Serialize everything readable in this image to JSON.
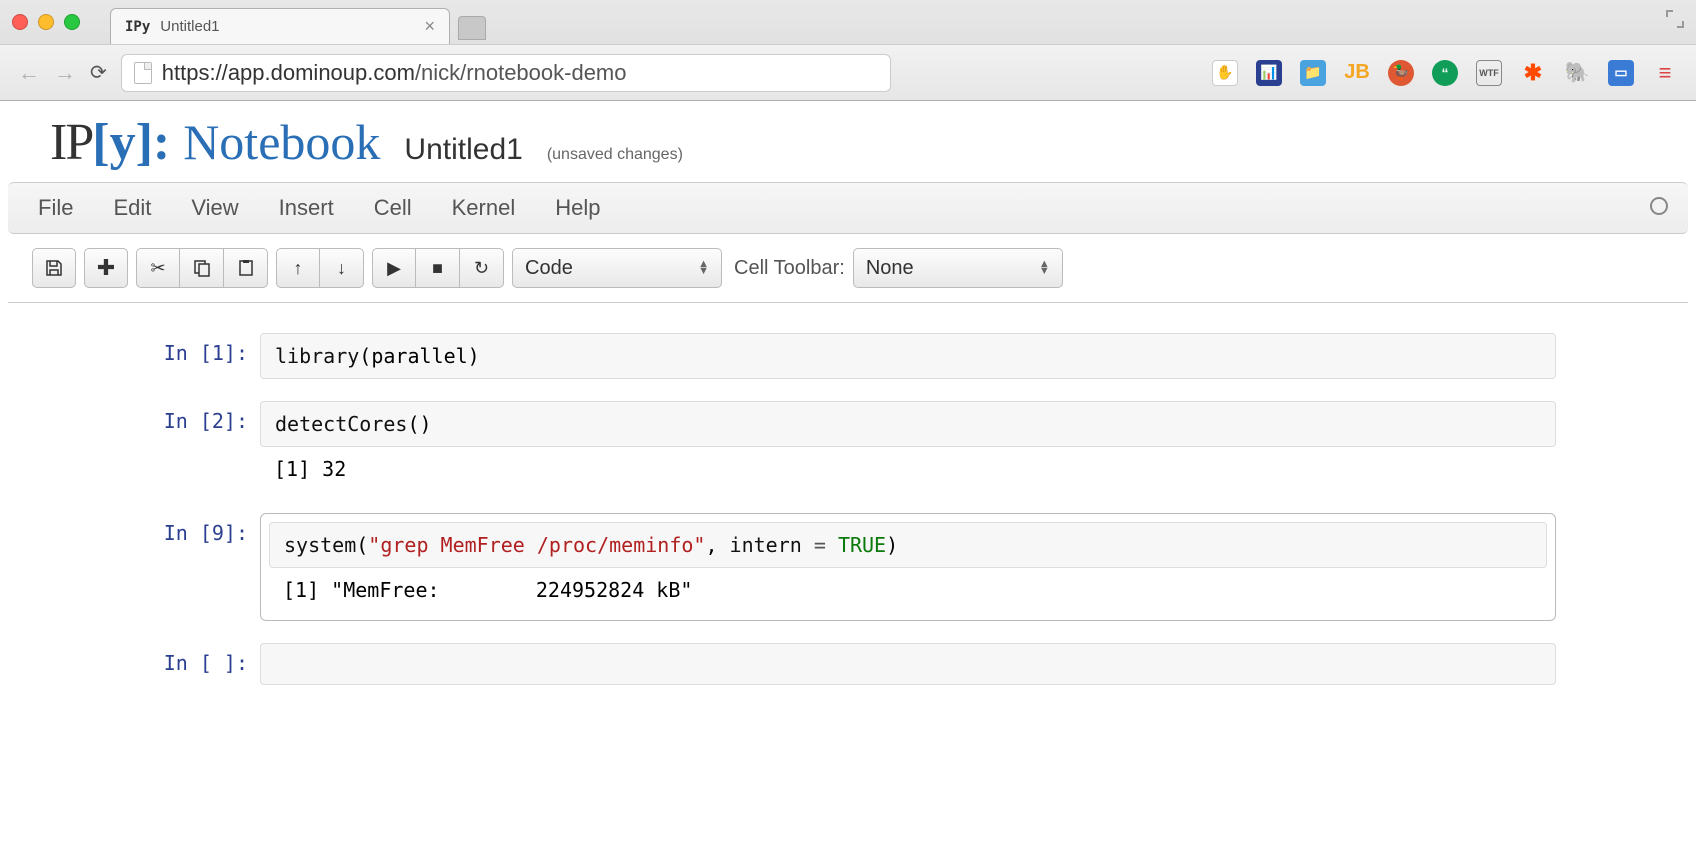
{
  "browser": {
    "tab_favicon": "IPy",
    "tab_title": "Untitled1",
    "url_scheme": "https://",
    "url_host": "app.dominoup.com",
    "url_path": "/nick/rnotebook-demo"
  },
  "header": {
    "logo_ip": "IP",
    "logo_y": "[y]:",
    "logo_nb": "Notebook",
    "title": "Untitled1",
    "status": "(unsaved changes)"
  },
  "menubar": {
    "file": "File",
    "edit": "Edit",
    "view": "View",
    "insert": "Insert",
    "cell": "Cell",
    "kernel": "Kernel",
    "help": "Help"
  },
  "toolbar": {
    "celltype_value": "Code",
    "celltoolbar_label": "Cell Toolbar:",
    "celltoolbar_value": "None"
  },
  "cells": [
    {
      "prompt": "In [1]:",
      "code_plain": "library(parallel)",
      "output": ""
    },
    {
      "prompt": "In [2]:",
      "code_plain": "detectCores()",
      "output": "[1] 32"
    },
    {
      "prompt": "In [9]:",
      "code_plain": "system(\"grep MemFree /proc/meminfo\", intern = TRUE)",
      "output": "[1] \"MemFree:        224952824 kB\""
    },
    {
      "prompt": "In [ ]:",
      "code_plain": "",
      "output": ""
    }
  ]
}
